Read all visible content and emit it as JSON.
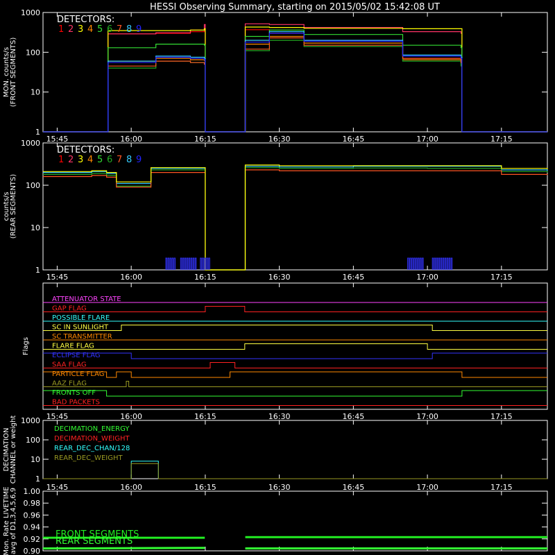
{
  "title": "HESSI Observing Summary, starting on 2015/05/02 15:42:08 UT",
  "colors": {
    "bg": "#000000",
    "axes": "#ffffff",
    "det": [
      "#ff0000",
      "#ff3366",
      "#ffff00",
      "#ff8800",
      "#33dd33",
      "#22aa22",
      "#ff5522",
      "#33ccff",
      "#2222ff"
    ],
    "magenta": "#ff44ff",
    "red": "#ff2222",
    "cyan": "#33ffff",
    "yellow": "#ffff44",
    "blue": "#3333ff",
    "orange": "#ff8800",
    "olive": "#999922",
    "green": "#33ff33",
    "bright_green": "#22ee22"
  },
  "xaxis": {
    "ticks": [
      {
        "t": 0,
        "label": "15:45"
      },
      {
        "t": 15,
        "label": "16:00"
      },
      {
        "t": 30,
        "label": "16:15"
      },
      {
        "t": 45,
        "label": "16:30"
      },
      {
        "t": 60,
        "label": "16:45"
      },
      {
        "t": 75,
        "label": "17:00"
      },
      {
        "t": 90,
        "label": "17:15"
      }
    ],
    "range_minutes_from_1545": [
      -2.87,
      99.3
    ]
  },
  "chart_data": [
    {
      "type": "line",
      "panel": "monitor",
      "ylabel": "MON. counts/s\n(FRONT SEGMENTS)",
      "yscale": "log",
      "ylim": [
        1,
        1000
      ],
      "yticks": [
        {
          "v": 1,
          "label": "1"
        },
        {
          "v": 10,
          "label": "10"
        },
        {
          "v": 100,
          "label": "100"
        },
        {
          "v": 1000,
          "label": "1000"
        }
      ],
      "legend_title": "DETECTORS:",
      "legend_labels": [
        "1",
        "2",
        "3",
        "4",
        "5",
        "6",
        "7",
        "8",
        "9"
      ],
      "x": [
        -2.87,
        10.2,
        10.3,
        20,
        27,
        29.8,
        30.0,
        38.0,
        38.1,
        43,
        50,
        70,
        81.8,
        82.0,
        99.3
      ],
      "series": [
        {
          "name": "1",
          "values": [
            1,
            1,
            290,
            300,
            330,
            380,
            1,
            1,
            370,
            300,
            190,
            70,
            60,
            1,
            1
          ]
        },
        {
          "name": "2",
          "values": [
            1,
            1,
            290,
            310,
            360,
            500,
            1,
            1,
            520,
            500,
            420,
            330,
            300,
            1,
            1
          ]
        },
        {
          "name": "3",
          "values": [
            1,
            1,
            350,
            350,
            360,
            390,
            1,
            1,
            430,
            420,
            400,
            390,
            390,
            1,
            1
          ]
        },
        {
          "name": "4",
          "values": [
            1,
            1,
            60,
            70,
            65,
            62,
            1,
            1,
            160,
            250,
            170,
            65,
            50,
            1,
            1
          ]
        },
        {
          "name": "5",
          "values": [
            1,
            1,
            130,
            160,
            160,
            150,
            1,
            1,
            250,
            360,
            280,
            150,
            130,
            1,
            1
          ]
        },
        {
          "name": "6",
          "values": [
            1,
            1,
            40,
            60,
            55,
            55,
            1,
            1,
            110,
            200,
            140,
            60,
            45,
            1,
            1
          ]
        },
        {
          "name": "7",
          "values": [
            1,
            1,
            45,
            60,
            55,
            50,
            1,
            1,
            120,
            230,
            150,
            70,
            55,
            1,
            1
          ]
        },
        {
          "name": "8",
          "values": [
            1,
            1,
            60,
            80,
            75,
            70,
            1,
            1,
            200,
            330,
            200,
            85,
            75,
            1,
            1
          ]
        },
        {
          "name": "9",
          "values": [
            1,
            1,
            55,
            75,
            70,
            65,
            1,
            1,
            180,
            300,
            190,
            80,
            70,
            1,
            1
          ]
        }
      ]
    },
    {
      "type": "line",
      "panel": "rear",
      "ylabel": "counts/s\n(REAR SEGMENTS)",
      "yscale": "log",
      "ylim": [
        1,
        1000
      ],
      "yticks": [
        {
          "v": 1,
          "label": "1"
        },
        {
          "v": 10,
          "label": "10"
        },
        {
          "v": 100,
          "label": "100"
        },
        {
          "v": 1000,
          "label": "1000"
        }
      ],
      "legend_title": "DETECTORS:",
      "legend_labels": [
        "1",
        "2",
        "3",
        "4",
        "5",
        "6",
        "7",
        "8",
        "9"
      ],
      "x": [
        -2.87,
        7,
        10,
        12,
        15,
        19,
        27,
        29.8,
        30.0,
        38.0,
        38.1,
        45,
        60,
        75,
        90,
        99.3
      ],
      "series": [
        {
          "name": "8",
          "values": [
            200,
            210,
            190,
            110,
            110,
            250,
            250,
            250,
            1,
            1,
            280,
            270,
            280,
            280,
            230,
            220
          ]
        },
        {
          "name": "6",
          "values": [
            180,
            190,
            170,
            95,
            95,
            230,
            230,
            230,
            1,
            1,
            260,
            250,
            255,
            250,
            210,
            200
          ]
        },
        {
          "name": "7",
          "values": [
            160,
            170,
            155,
            90,
            90,
            200,
            200,
            200,
            1,
            1,
            230,
            220,
            220,
            220,
            180,
            175
          ]
        },
        {
          "name": "3",
          "values": [
            210,
            220,
            200,
            120,
            120,
            260,
            260,
            260,
            1,
            1,
            300,
            290,
            290,
            290,
            250,
            240
          ]
        }
      ],
      "blue_bursts_minutes": [
        [
          22,
          24
        ],
        [
          25,
          28
        ],
        [
          29,
          31
        ],
        [
          71,
          74
        ],
        [
          76,
          80
        ]
      ]
    },
    {
      "type": "line",
      "panel": "flags",
      "ylabel": "Flags",
      "flags": [
        {
          "label": "ATTENUATOR STATE",
          "color": "magenta",
          "x": [
            -2.87,
            99.3
          ],
          "v": [
            0,
            0
          ]
        },
        {
          "label": "GAP FLAG",
          "color": "red",
          "x": [
            -2.87,
            30,
            30,
            38,
            38,
            99.3
          ],
          "v": [
            0,
            0,
            1,
            1,
            0,
            0
          ]
        },
        {
          "label": "POSSIBLE FLARE",
          "color": "cyan",
          "x": [
            -2.87,
            99.3
          ],
          "v": [
            0,
            0
          ]
        },
        {
          "label": "SC IN SUNLIGHT",
          "color": "yellow",
          "x": [
            -2.87,
            13,
            13,
            76,
            76,
            99.3
          ],
          "v": [
            0,
            0,
            1,
            1,
            0,
            0
          ]
        },
        {
          "label": "SC TRANSMITTER",
          "color": "orange",
          "x": [
            -2.87,
            99.3
          ],
          "v": [
            0,
            0
          ]
        },
        {
          "label": "FLARE FLAG",
          "color": "yellow",
          "x": [
            -2.87,
            38,
            38,
            75,
            75,
            99.3
          ],
          "v": [
            0,
            0,
            1,
            1,
            0,
            0
          ]
        },
        {
          "label": "ECLIPSE FLAG",
          "color": "blue",
          "x": [
            -2.87,
            15,
            15,
            76,
            76,
            99.3
          ],
          "v": [
            1,
            1,
            0,
            0,
            1,
            1
          ]
        },
        {
          "label": "SAA FLAG",
          "color": "red",
          "x": [
            -2.87,
            31,
            31,
            36,
            36,
            99.3
          ],
          "v": [
            0,
            0,
            1,
            1,
            0,
            0
          ]
        },
        {
          "label": "PARTICLE FLAG",
          "color": "orange",
          "x": [
            -2.87,
            10,
            10,
            12,
            12,
            15,
            15,
            35,
            35,
            82,
            82,
            99.3
          ],
          "v": [
            1,
            1,
            0,
            0,
            1,
            1,
            0,
            0,
            1,
            1,
            0,
            0
          ]
        },
        {
          "label": "AAZ FLAG",
          "color": "olive",
          "x": [
            -2.87,
            14,
            14,
            14.5,
            14.5,
            99.3
          ],
          "v": [
            0,
            0,
            1,
            1,
            0,
            0
          ]
        },
        {
          "label": "FRONTS OFF",
          "color": "green",
          "x": [
            -2.87,
            10,
            10,
            82,
            82,
            99.3
          ],
          "v": [
            1,
            1,
            0,
            0,
            1,
            1
          ]
        },
        {
          "label": "BAD PACKETS",
          "color": "red",
          "x": [
            -2.87,
            99.3
          ],
          "v": [
            0,
            0
          ]
        }
      ]
    },
    {
      "type": "line",
      "panel": "decimation",
      "ylabel": "DECIMATION\nCHANNEL or weight",
      "yscale": "log",
      "ylim": [
        1,
        1000
      ],
      "yticks": [
        {
          "v": 1,
          "label": "1"
        },
        {
          "v": 10,
          "label": "10"
        },
        {
          "v": 100,
          "label": "100"
        },
        {
          "v": 1000,
          "label": "1000"
        }
      ],
      "legend": [
        "DECIMATION_ENERGY",
        "DECIMATION_WEIGHT",
        "REAR_DEC_CHAN/128",
        "REAR_DEC_WEIGHT"
      ],
      "legend_colors": [
        "green",
        "red",
        "cyan",
        "olive"
      ],
      "series": [
        {
          "name": "REAR_DEC_CHAN/128",
          "color": "cyan",
          "x": [
            -2.87,
            15,
            15,
            20.5,
            20.5,
            99.3
          ],
          "values": [
            1,
            1,
            8,
            8,
            1,
            1
          ]
        },
        {
          "name": "REAR_DEC_WEIGHT",
          "color": "olive",
          "x": [
            -2.87,
            15,
            15,
            20.5,
            20.5,
            99.3
          ],
          "values": [
            1,
            1,
            6,
            6,
            1,
            1
          ]
        }
      ]
    },
    {
      "type": "line",
      "panel": "livetime",
      "ylabel": "Mon. Rate LIVETIME\navg of D1,3,4,5,6,9",
      "ylim": [
        0.9,
        1.0
      ],
      "yticks": [
        {
          "v": 0.9,
          "label": "0.90"
        },
        {
          "v": 0.92,
          "label": "0.92"
        },
        {
          "v": 0.94,
          "label": "0.94"
        },
        {
          "v": 0.96,
          "label": "0.96"
        },
        {
          "v": 0.98,
          "label": "0.98"
        },
        {
          "v": 1.0,
          "label": "1.00"
        }
      ],
      "legend": [
        "FRONT SEGMENTS",
        "REAR SEGMENTS"
      ],
      "series": [
        {
          "name": "FRONT SEGMENTS",
          "color": "bright_green",
          "x": [
            -2.87,
            29.9,
            38.1,
            99.3
          ],
          "values": [
            0.922,
            0.922,
            0.923,
            0.923
          ]
        },
        {
          "name": "REAR SEGMENTS",
          "color": "green",
          "x": [
            -2.87,
            29.9,
            38.1,
            99.3
          ],
          "values": [
            0.904,
            0.905,
            0.904,
            0.904
          ]
        }
      ]
    }
  ]
}
